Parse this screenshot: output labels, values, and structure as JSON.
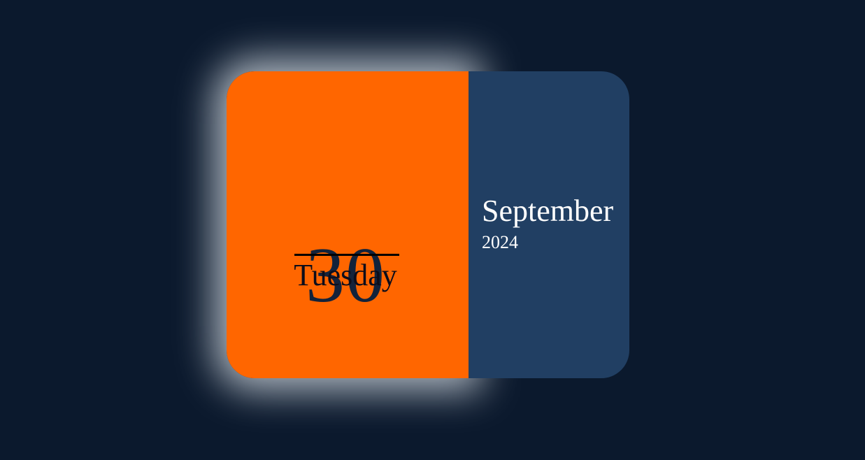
{
  "calendar": {
    "day_number": "30",
    "weekday": "Tuesday",
    "month": "September",
    "year": "2024"
  },
  "colors": {
    "background": "#0b192d",
    "day_panel": "#ff6600",
    "month_panel": "#213f63",
    "day_text": "#13233b",
    "month_text": "#ffffff"
  }
}
